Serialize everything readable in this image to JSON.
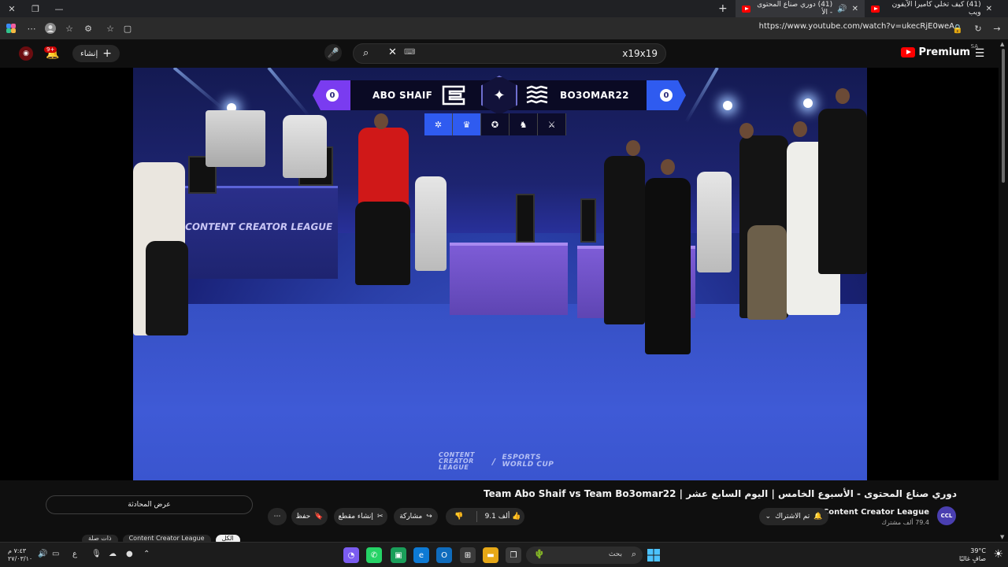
{
  "browser": {
    "tabs": [
      {
        "title": "(41) كيف تخلي كاميرا الآيفون ويب",
        "active": false
      },
      {
        "title": "(41) دوري صناع المحتوى - الأ",
        "active": true
      }
    ],
    "url": "https://www.youtube.com/watch?v=ukecRjE0weA"
  },
  "youtube": {
    "search_query": "x19x19",
    "create_label": "إنشاء",
    "notification_count": "9+",
    "premium_label": "Premium",
    "region_code": "SA"
  },
  "video": {
    "scoreboard": {
      "team_left": "ABO SHAIF",
      "team_right": "BO3OMAR22",
      "score_left": "0",
      "score_right": "0"
    },
    "league_text": "CONTENT CREATOR LEAGUE",
    "watermark_left": "CONTENT CREATOR LEAGUE",
    "watermark_right": "ESPORTS WORLD CUP"
  },
  "watch": {
    "title": "دوري صناع المحتوى - الأسبوع الخامس | اليوم السابع عشر | Team Abo Shaif vs Team Bo3omar22",
    "channel_name": "Content Creator League",
    "subscribers": "79.4 ألف مشترك",
    "subscribed_label": "تم الاشتراك",
    "likes": "9.1 ألف",
    "share_label": "مشاركة",
    "clip_label": "إنشاء مقطع",
    "save_label": "حفظ",
    "chat_label": "عرض المحادثة",
    "chips": [
      "الكل",
      "Content Creator League",
      "ذات صلة"
    ]
  },
  "taskbar": {
    "search_label": "بحث",
    "weather_temp": "39°C",
    "weather_desc": "صافٍ غالبًا",
    "time": "٧:٤٣ م",
    "date": "٢٧/٠٣/١٠"
  }
}
